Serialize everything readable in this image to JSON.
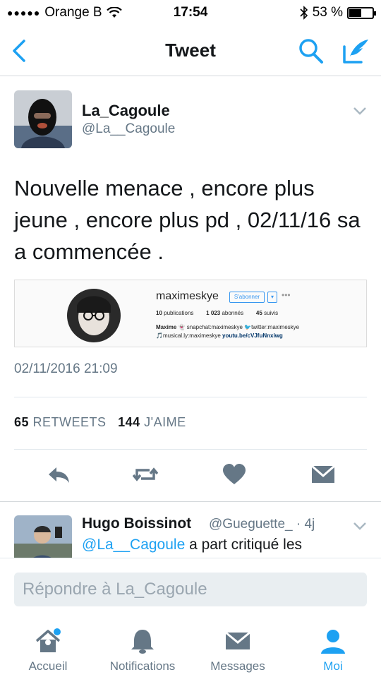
{
  "status_bar": {
    "carrier": "Orange B",
    "time": "17:54",
    "battery": "53 %",
    "battery_level": 0.53
  },
  "nav": {
    "title": "Tweet"
  },
  "tweet": {
    "author_name": "La_Cagoule",
    "author_handle": "@La__Cagoule",
    "text": "Nouvelle menace , encore plus jeune , encore plus pd , 02/11/16 sa a commencée .",
    "timestamp": "02/11/2016 21:09",
    "retweets_count": "65",
    "retweets_label": "RETWEETS",
    "likes_count": "144",
    "likes_label": "J'AIME",
    "media": {
      "username": "maximeskye",
      "follow_label": "S'abonner",
      "dropdown": "▾",
      "more": "•••",
      "publications_count": "10",
      "publications_label": "publications",
      "followers_count": "1 023",
      "followers_label": "abonnés",
      "following_count": "45",
      "following_label": "suivis",
      "bio_line1_name": "Maxime",
      "bio_line1_snap": "snapchat:maximeskye",
      "bio_line1_twitter": "twitter:maximeskye",
      "bio_line2_musical": "musical.ly:maximeskye",
      "bio_line2_link": "youtu.be/cVJfuNnxiwg"
    }
  },
  "reply": {
    "author_name": "Hugo Boissinot",
    "author_handle": "@Gueguette_",
    "age": "· 4j",
    "mention": "@La__Cagoule",
    "text": " a part critiqué les"
  },
  "reply_bar": {
    "placeholder": "Répondre à La_Cagoule"
  },
  "tabs": [
    {
      "label": "Accueil",
      "icon": "home-icon",
      "has_badge": true
    },
    {
      "label": "Notifications",
      "icon": "bell-icon"
    },
    {
      "label": "Messages",
      "icon": "envelope-icon"
    },
    {
      "label": "Moi",
      "icon": "person-icon",
      "active": true
    }
  ],
  "colors": {
    "accent": "#1da1f2",
    "muted": "#657786",
    "action_icon": "#657786"
  }
}
